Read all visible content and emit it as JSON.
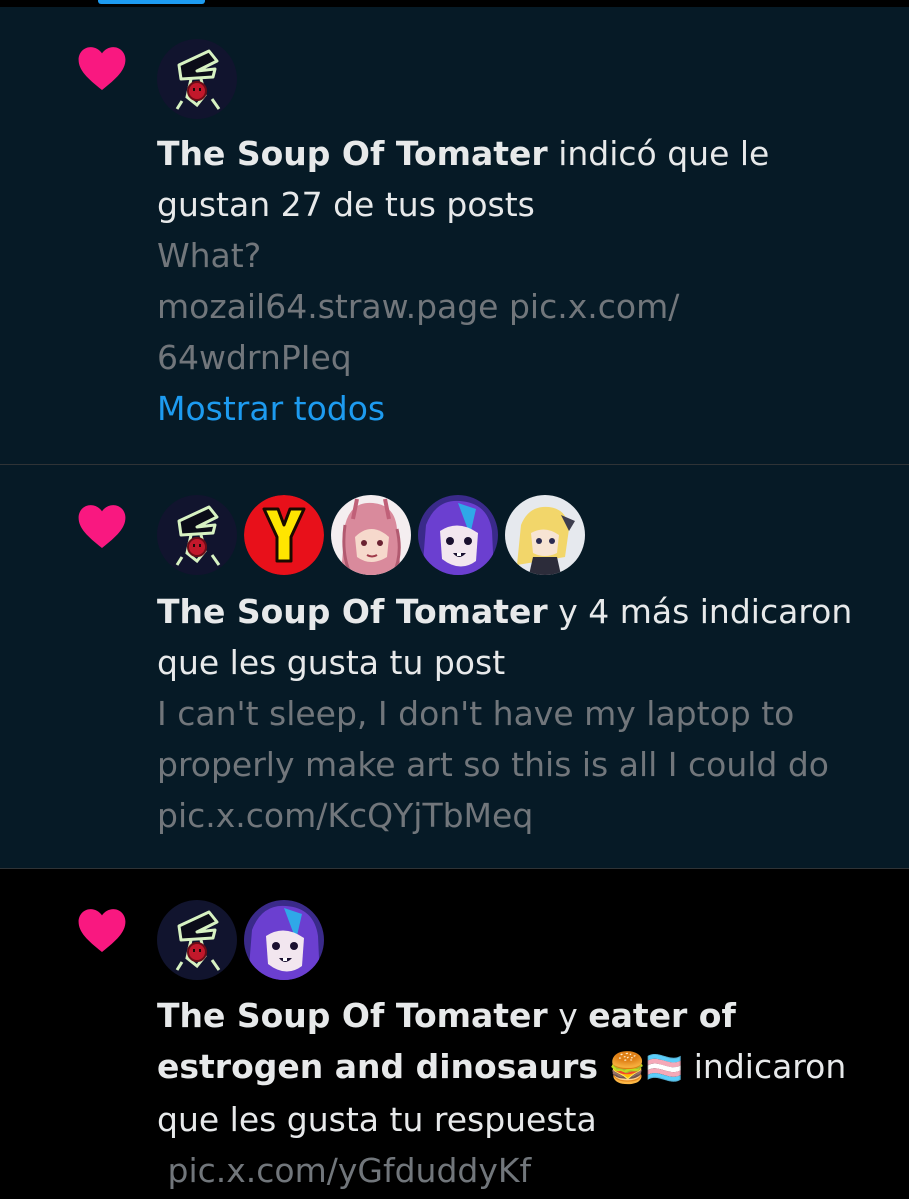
{
  "notifications": [
    {
      "user": "The Soup Of Tomater",
      "action": " indicó que le gustan 27 de tus posts",
      "preview_lines": [
        "What?",
        "mozail64.straw.page pic.x.com/",
        "64wdrnPIeq"
      ],
      "show_all": "Mostrar todos"
    },
    {
      "user": "The Soup Of Tomater",
      "action": " y 4 más indicaron que les gusta tu post",
      "preview_lines": [
        "I can't sleep, I don't have my laptop to",
        "properly make art so this is all I could do",
        "pic.x.com/KcQYjTbMeq"
      ]
    },
    {
      "user": "The Soup Of Tomater",
      "connector": " y ",
      "user2": "eater of estrogen and dinosaurs",
      "emoji": "🍔🏳️‍⚧️",
      "action": " indicaron que les gusta tu respuesta",
      "preview_lines": [
        " pic.x.com/yGfduddyKf"
      ]
    }
  ],
  "colors": {
    "like_heart": "#f91880",
    "link": "#1d9bf0",
    "unread_bg": "#061a26",
    "read_bg": "#000000",
    "secondary_text": "#71767b"
  },
  "icons": [
    "heart-icon",
    "avatar-soup-of-tomater",
    "avatar-y-logo",
    "avatar-pink-haired",
    "avatar-purple-haired",
    "avatar-blonde"
  ]
}
